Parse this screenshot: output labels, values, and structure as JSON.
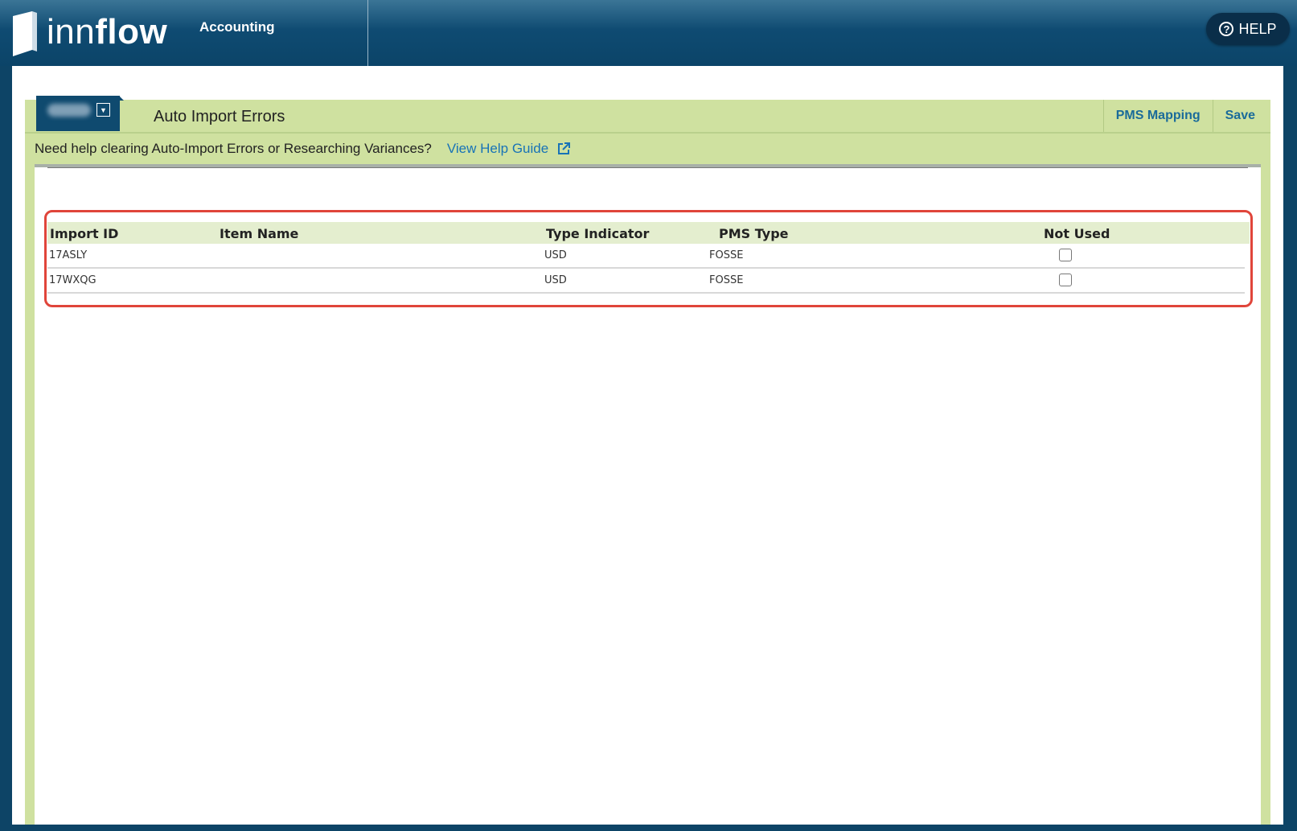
{
  "header": {
    "logo_part1": "inn",
    "logo_part2": "flow",
    "app_name": "Accounting",
    "help_label": "HELP"
  },
  "panel": {
    "title": "Auto Import Errors",
    "actions": [
      "PMS Mapping",
      "Save"
    ],
    "help_text": "Need help clearing Auto-Import Errors or Researching Variances?",
    "help_link": "View Help Guide"
  },
  "table": {
    "columns": [
      "Import ID",
      "Item Name",
      "Type Indicator",
      "PMS Type",
      "Not Used"
    ],
    "rows": [
      {
        "import_id": "17ASLY",
        "item_name": "",
        "type_indicator": "USD",
        "pms_type": "FOSSE",
        "not_used": false
      },
      {
        "import_id": "17WXQG",
        "item_name": "",
        "type_indicator": "USD",
        "pms_type": "FOSSE",
        "not_used": false
      }
    ]
  },
  "colors": {
    "header_blue": "#0f4b72",
    "panel_green": "#cfe1a0",
    "link_blue": "#1873b7",
    "highlight_red": "#e0453a"
  },
  "icons": [
    "innflow-logo-icon",
    "help-circle-icon",
    "dropdown-arrow-icon",
    "external-link-icon",
    "checkbox-icon"
  ]
}
